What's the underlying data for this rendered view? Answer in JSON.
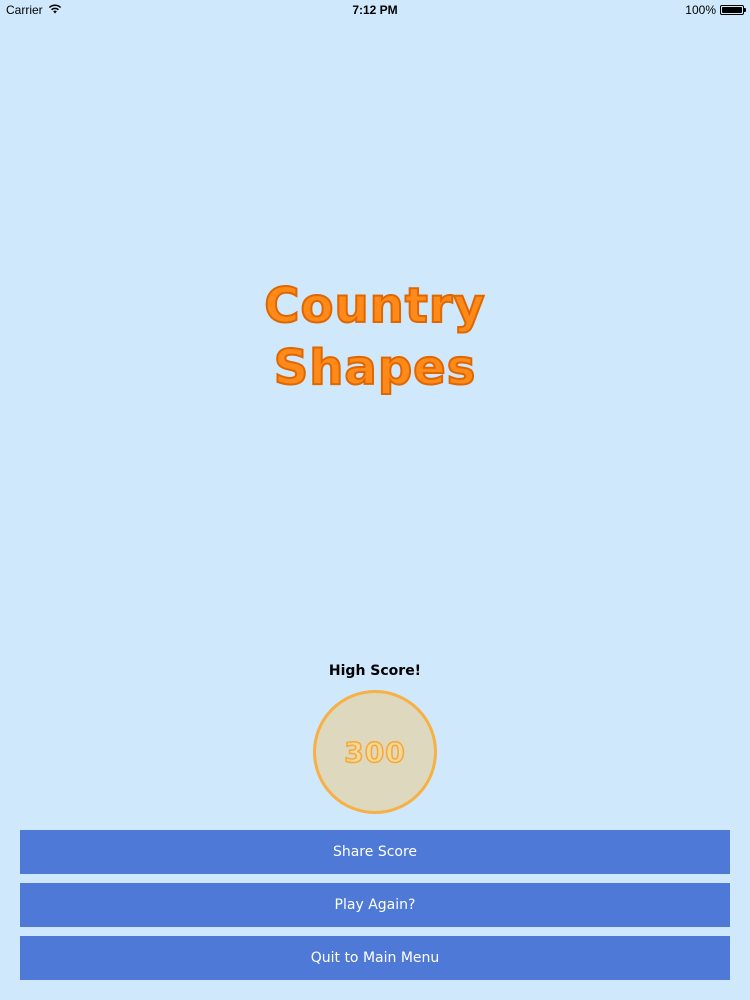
{
  "status_bar": {
    "carrier": "Carrier",
    "time": "7:12 PM",
    "battery": "100%",
    "battery_level": 1.0
  },
  "title": {
    "line1": "Country",
    "line2": "Shapes"
  },
  "high_score": {
    "label": "High Score!",
    "value": "300"
  },
  "buttons": {
    "share": "Share Score",
    "play_again": "Play Again?",
    "quit": "Quit to Main Menu"
  },
  "colors": {
    "background": "#cfe8fb",
    "button": "#4f79d6",
    "title": "#ff8a1a",
    "score_circle": "#ddd8be"
  }
}
